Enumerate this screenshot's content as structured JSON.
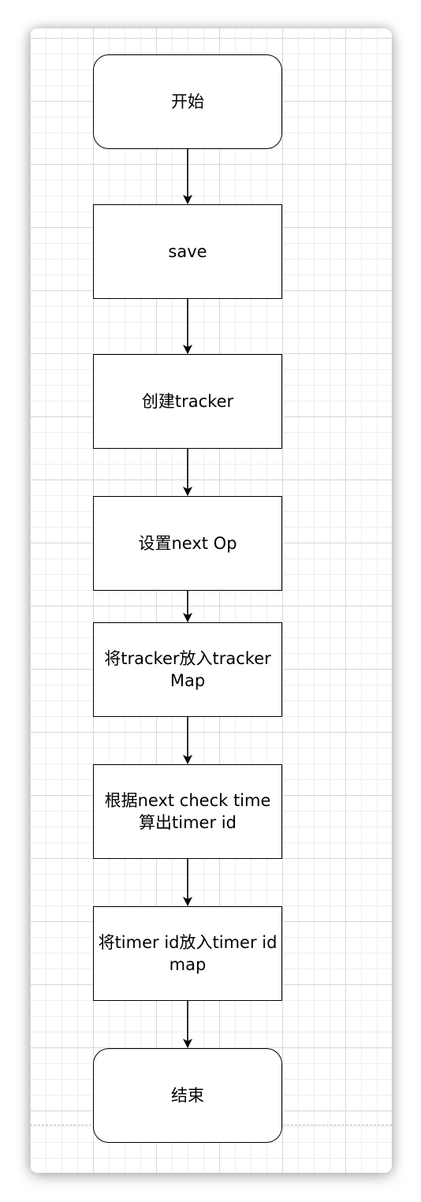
{
  "flowchart": {
    "nodes": [
      {
        "id": "start",
        "shape": "rounded",
        "label": "开始"
      },
      {
        "id": "save",
        "shape": "rect",
        "label": "save"
      },
      {
        "id": "create_tracker",
        "shape": "rect",
        "label": "创建tracker"
      },
      {
        "id": "set_next_op",
        "shape": "rect",
        "label": "设置next Op"
      },
      {
        "id": "put_tracker",
        "shape": "rect",
        "label": "将tracker放入tracker\nMap"
      },
      {
        "id": "calc_timer_id",
        "shape": "rect",
        "label": "根据next check time\n算出timer id"
      },
      {
        "id": "put_timer_id",
        "shape": "rect",
        "label": "将timer id放入timer id\nmap"
      },
      {
        "id": "end",
        "shape": "rounded",
        "label": "结束"
      }
    ],
    "edges": [
      {
        "from": "start",
        "to": "save"
      },
      {
        "from": "save",
        "to": "create_tracker"
      },
      {
        "from": "create_tracker",
        "to": "set_next_op"
      },
      {
        "from": "set_next_op",
        "to": "put_tracker"
      },
      {
        "from": "put_tracker",
        "to": "calc_timer_id"
      },
      {
        "from": "calc_timer_id",
        "to": "put_timer_id"
      },
      {
        "from": "put_timer_id",
        "to": "end"
      }
    ]
  },
  "colors": {
    "stroke": "#000000",
    "fill": "#ffffff",
    "grid_major": "#d6d6d6",
    "grid_minor": "#eeeeee"
  }
}
